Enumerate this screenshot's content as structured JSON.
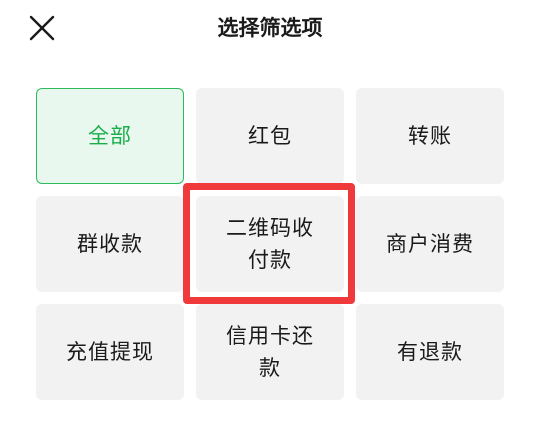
{
  "header": {
    "title": "选择筛选项",
    "close_icon": "close-icon"
  },
  "options": [
    {
      "label": "全部",
      "selected": true
    },
    {
      "label": "红包",
      "selected": false
    },
    {
      "label": "转账",
      "selected": false
    },
    {
      "label": "群收款",
      "selected": false
    },
    {
      "label": "二维码收付款",
      "selected": false
    },
    {
      "label": "商户消费",
      "selected": false
    },
    {
      "label": "充值提现",
      "selected": false
    },
    {
      "label": "信用卡还款",
      "selected": false
    },
    {
      "label": "有退款",
      "selected": false
    }
  ],
  "colors": {
    "selected_text": "#1aad4b",
    "selected_border": "#2bbd5c",
    "selected_bg": "#e9f8ee",
    "cell_bg": "#f2f2f2",
    "highlight": "#f0393b"
  }
}
